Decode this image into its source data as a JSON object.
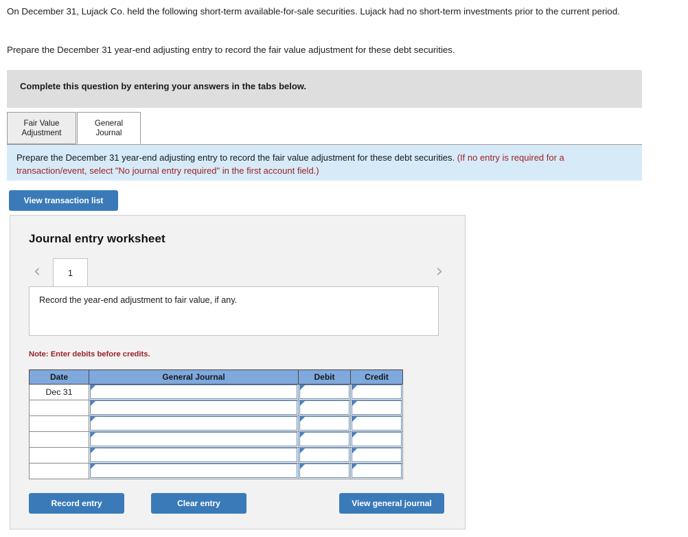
{
  "intro": {
    "paragraph1": "On December 31, Lujack Co. held the following short-term available-for-sale securities. Lujack had no short-term investments prior to the current period.",
    "paragraph2": "Prepare the December 31 year-end adjusting entry to record the fair value adjustment for these debt securities."
  },
  "banner": {
    "text": "Complete this question by entering your answers in the tabs below."
  },
  "tabs": [
    {
      "label": "Fair Value\nAdjustment",
      "line1": "Fair Value",
      "line2": "Adjustment",
      "active": false
    },
    {
      "label": "General\nJournal",
      "line1": "General",
      "line2": "Journal",
      "active": true
    }
  ],
  "requirement": {
    "black_text": "Prepare the December 31 year-end adjusting entry to record the fair value adjustment for these debt securities.",
    "red_text": "(If no entry is required for a transaction/event, select \"No journal entry required\" in the first account field.)"
  },
  "buttons": {
    "view_transaction_list": "View transaction list",
    "record_entry": "Record entry",
    "clear_entry": "Clear entry",
    "view_general_journal": "View general journal"
  },
  "worksheet": {
    "title": "Journal entry worksheet",
    "pager": {
      "prev_icon": "chevron-left-icon",
      "next_icon": "chevron-right-icon",
      "current_page": "1"
    },
    "description": "Record the year-end adjustment to fair value, if any.",
    "note": "Note: Enter debits before credits.",
    "table": {
      "headers": [
        "Date",
        "General Journal",
        "Debit",
        "Credit"
      ],
      "rows": [
        {
          "date": "Dec 31",
          "general_journal": "",
          "debit": "",
          "credit": ""
        },
        {
          "date": "",
          "general_journal": "",
          "debit": "",
          "credit": ""
        },
        {
          "date": "",
          "general_journal": "",
          "debit": "",
          "credit": ""
        },
        {
          "date": "",
          "general_journal": "",
          "debit": "",
          "credit": ""
        },
        {
          "date": "",
          "general_journal": "",
          "debit": "",
          "credit": ""
        },
        {
          "date": "",
          "general_journal": "",
          "debit": "",
          "credit": ""
        }
      ]
    }
  },
  "colors": {
    "button_blue": "#3a7ab8",
    "table_header_blue": "#7fa8dc",
    "requirement_panel_blue": "#d7eaf8",
    "banner_gray": "#dedede",
    "red_text": "#9b2226",
    "field_border_blue": "#5b8dc8"
  }
}
